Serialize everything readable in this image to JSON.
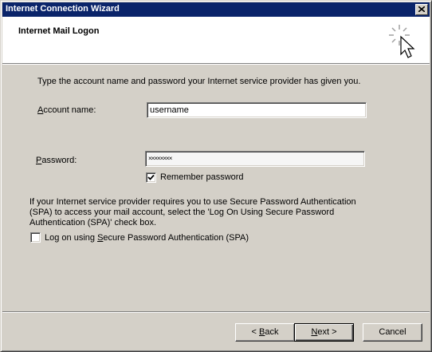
{
  "window": {
    "title": "Internet Connection Wizard"
  },
  "header": {
    "title": "Internet Mail Logon",
    "icon": "wizard-cursor-icon"
  },
  "intro_text": "Type the account name and password your Internet service provider has given you.",
  "account": {
    "label_pre": "",
    "label_accel": "A",
    "label_post": "ccount name:",
    "value": "username"
  },
  "password": {
    "label_pre": "",
    "label_accel": "P",
    "label_post": "assword:",
    "value": "××××××××"
  },
  "remember": {
    "label": "Remember password",
    "checked": true
  },
  "spa_info": {
    "line1": "If your Internet service provider requires you to use Secure Password Authentication",
    "line2": "(SPA) to access your mail account, select the 'Log On Using Secure Password",
    "line3": "Authentication (SPA)' check box."
  },
  "spa": {
    "label_pre": "Log on using ",
    "label_accel": "S",
    "label_post": "ecure Password Authentication (SPA)",
    "checked": false
  },
  "buttons": {
    "back": {
      "pre": "< ",
      "accel": "B",
      "post": "ack"
    },
    "next": {
      "pre": "",
      "accel": "N",
      "post": "ext >"
    },
    "cancel": "Cancel"
  }
}
